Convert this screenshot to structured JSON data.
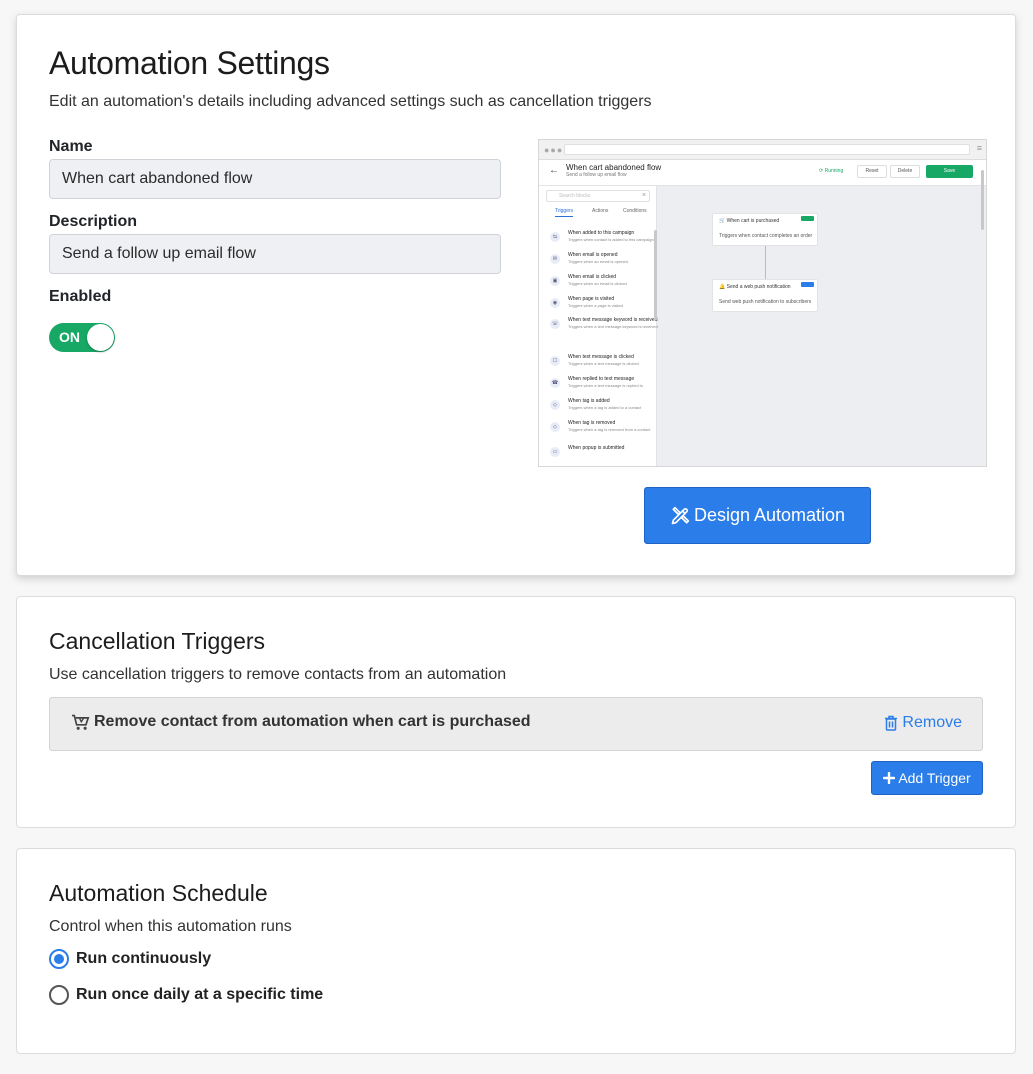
{
  "settings": {
    "title": "Automation Settings",
    "subtitle": "Edit an automation's details including advanced settings such as cancellation triggers",
    "name_label": "Name",
    "name_value": "When cart abandoned flow",
    "description_label": "Description",
    "description_value": "Send a follow up email flow",
    "enabled_label": "Enabled",
    "toggle_text": "ON",
    "design_button": "Design Automation"
  },
  "preview": {
    "title": "When cart abandoned flow",
    "subtitle": "Send a follow up email flow",
    "status": "Running",
    "reset": "Reset",
    "delete": "Delete",
    "save": "Save",
    "search_placeholder": "Search blocks",
    "tabs": [
      "Triggers",
      "Actions",
      "Conditions"
    ],
    "items": [
      {
        "title": "When added to this campaign",
        "desc": "Triggers when contact is added to this campaign"
      },
      {
        "title": "When email is opened",
        "desc": "Triggers when an email is opened"
      },
      {
        "title": "When email is clicked",
        "desc": "Triggers when an email is clicked"
      },
      {
        "title": "When page is visited",
        "desc": "Triggers when a page is visited"
      },
      {
        "title": "When text message keyword is received",
        "desc": "Triggers when a text message keyword is received"
      },
      {
        "title": "When text message is clicked",
        "desc": "Triggers when a text message is clicked"
      },
      {
        "title": "When replied to text message",
        "desc": "Triggers when a text message is replied to"
      },
      {
        "title": "When tag is added",
        "desc": "Triggers when a tag is added to a contact"
      },
      {
        "title": "When tag is removed",
        "desc": "Triggers when a tag is removed from a contact"
      },
      {
        "title": "When popup is submitted",
        "desc": ""
      }
    ],
    "node1_title": "When cart is purchased",
    "node1_desc": "Triggers when contact completes an order",
    "node2_title": "Send a web push notification",
    "node2_desc": "Send web push notification to subscribers"
  },
  "cancellation": {
    "title": "Cancellation Triggers",
    "subtitle": "Use cancellation triggers to remove contacts from an automation",
    "trigger_text": "Remove contact from automation when cart is purchased",
    "remove_label": "Remove",
    "add_button": "Add Trigger"
  },
  "schedule": {
    "title": "Automation Schedule",
    "subtitle": "Control when this automation runs",
    "option_continuous": "Run continuously",
    "option_daily": "Run once daily at a specific time",
    "selected": "Run continuously"
  },
  "colors": {
    "primary": "#2b7de9",
    "success": "#17a865",
    "text": "#212529"
  },
  "icons": {
    "design": "pencil-ruler-icon",
    "cart": "cart-icon",
    "trash": "trash-icon",
    "plus": "plus-icon"
  }
}
